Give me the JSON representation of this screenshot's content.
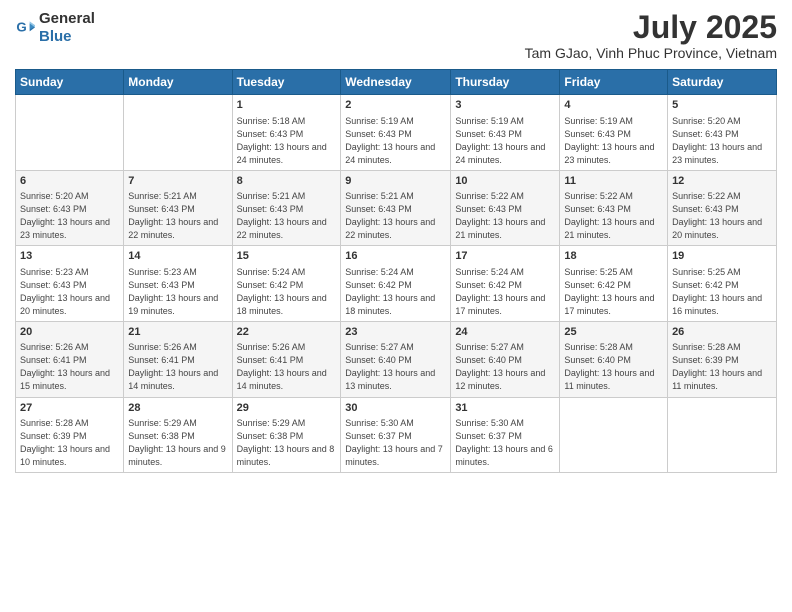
{
  "header": {
    "logo_general": "General",
    "logo_blue": "Blue",
    "month": "July 2025",
    "location": "Tam GJao, Vinh Phuc Province, Vietnam"
  },
  "weekdays": [
    "Sunday",
    "Monday",
    "Tuesday",
    "Wednesday",
    "Thursday",
    "Friday",
    "Saturday"
  ],
  "weeks": [
    [
      {
        "day": "",
        "info": ""
      },
      {
        "day": "",
        "info": ""
      },
      {
        "day": "1",
        "info": "Sunrise: 5:18 AM\nSunset: 6:43 PM\nDaylight: 13 hours and 24 minutes."
      },
      {
        "day": "2",
        "info": "Sunrise: 5:19 AM\nSunset: 6:43 PM\nDaylight: 13 hours and 24 minutes."
      },
      {
        "day": "3",
        "info": "Sunrise: 5:19 AM\nSunset: 6:43 PM\nDaylight: 13 hours and 24 minutes."
      },
      {
        "day": "4",
        "info": "Sunrise: 5:19 AM\nSunset: 6:43 PM\nDaylight: 13 hours and 23 minutes."
      },
      {
        "day": "5",
        "info": "Sunrise: 5:20 AM\nSunset: 6:43 PM\nDaylight: 13 hours and 23 minutes."
      }
    ],
    [
      {
        "day": "6",
        "info": "Sunrise: 5:20 AM\nSunset: 6:43 PM\nDaylight: 13 hours and 23 minutes."
      },
      {
        "day": "7",
        "info": "Sunrise: 5:21 AM\nSunset: 6:43 PM\nDaylight: 13 hours and 22 minutes."
      },
      {
        "day": "8",
        "info": "Sunrise: 5:21 AM\nSunset: 6:43 PM\nDaylight: 13 hours and 22 minutes."
      },
      {
        "day": "9",
        "info": "Sunrise: 5:21 AM\nSunset: 6:43 PM\nDaylight: 13 hours and 22 minutes."
      },
      {
        "day": "10",
        "info": "Sunrise: 5:22 AM\nSunset: 6:43 PM\nDaylight: 13 hours and 21 minutes."
      },
      {
        "day": "11",
        "info": "Sunrise: 5:22 AM\nSunset: 6:43 PM\nDaylight: 13 hours and 21 minutes."
      },
      {
        "day": "12",
        "info": "Sunrise: 5:22 AM\nSunset: 6:43 PM\nDaylight: 13 hours and 20 minutes."
      }
    ],
    [
      {
        "day": "13",
        "info": "Sunrise: 5:23 AM\nSunset: 6:43 PM\nDaylight: 13 hours and 20 minutes."
      },
      {
        "day": "14",
        "info": "Sunrise: 5:23 AM\nSunset: 6:43 PM\nDaylight: 13 hours and 19 minutes."
      },
      {
        "day": "15",
        "info": "Sunrise: 5:24 AM\nSunset: 6:42 PM\nDaylight: 13 hours and 18 minutes."
      },
      {
        "day": "16",
        "info": "Sunrise: 5:24 AM\nSunset: 6:42 PM\nDaylight: 13 hours and 18 minutes."
      },
      {
        "day": "17",
        "info": "Sunrise: 5:24 AM\nSunset: 6:42 PM\nDaylight: 13 hours and 17 minutes."
      },
      {
        "day": "18",
        "info": "Sunrise: 5:25 AM\nSunset: 6:42 PM\nDaylight: 13 hours and 17 minutes."
      },
      {
        "day": "19",
        "info": "Sunrise: 5:25 AM\nSunset: 6:42 PM\nDaylight: 13 hours and 16 minutes."
      }
    ],
    [
      {
        "day": "20",
        "info": "Sunrise: 5:26 AM\nSunset: 6:41 PM\nDaylight: 13 hours and 15 minutes."
      },
      {
        "day": "21",
        "info": "Sunrise: 5:26 AM\nSunset: 6:41 PM\nDaylight: 13 hours and 14 minutes."
      },
      {
        "day": "22",
        "info": "Sunrise: 5:26 AM\nSunset: 6:41 PM\nDaylight: 13 hours and 14 minutes."
      },
      {
        "day": "23",
        "info": "Sunrise: 5:27 AM\nSunset: 6:40 PM\nDaylight: 13 hours and 13 minutes."
      },
      {
        "day": "24",
        "info": "Sunrise: 5:27 AM\nSunset: 6:40 PM\nDaylight: 13 hours and 12 minutes."
      },
      {
        "day": "25",
        "info": "Sunrise: 5:28 AM\nSunset: 6:40 PM\nDaylight: 13 hours and 11 minutes."
      },
      {
        "day": "26",
        "info": "Sunrise: 5:28 AM\nSunset: 6:39 PM\nDaylight: 13 hours and 11 minutes."
      }
    ],
    [
      {
        "day": "27",
        "info": "Sunrise: 5:28 AM\nSunset: 6:39 PM\nDaylight: 13 hours and 10 minutes."
      },
      {
        "day": "28",
        "info": "Sunrise: 5:29 AM\nSunset: 6:38 PM\nDaylight: 13 hours and 9 minutes."
      },
      {
        "day": "29",
        "info": "Sunrise: 5:29 AM\nSunset: 6:38 PM\nDaylight: 13 hours and 8 minutes."
      },
      {
        "day": "30",
        "info": "Sunrise: 5:30 AM\nSunset: 6:37 PM\nDaylight: 13 hours and 7 minutes."
      },
      {
        "day": "31",
        "info": "Sunrise: 5:30 AM\nSunset: 6:37 PM\nDaylight: 13 hours and 6 minutes."
      },
      {
        "day": "",
        "info": ""
      },
      {
        "day": "",
        "info": ""
      }
    ]
  ]
}
